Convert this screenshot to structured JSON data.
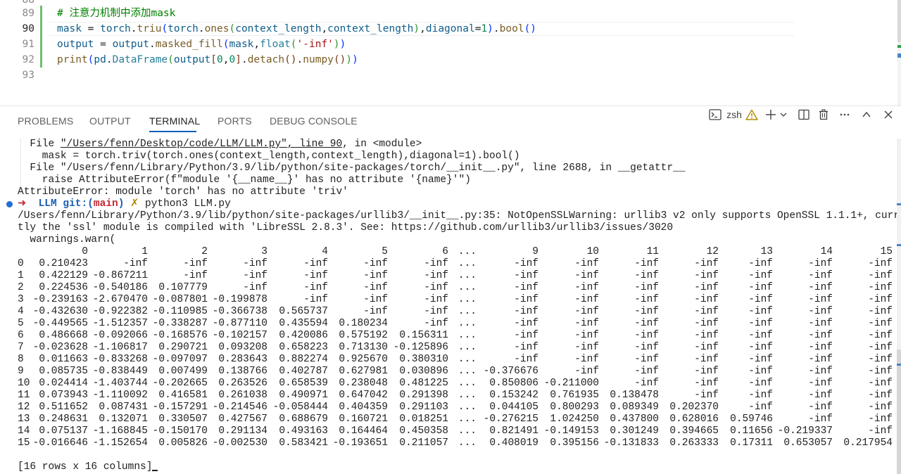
{
  "editor": {
    "lines": [
      {
        "num": "88",
        "tokens": []
      },
      {
        "num": "89",
        "tokens": [
          {
            "t": "# 注意力机制中添加mask",
            "c": "c-com"
          }
        ]
      },
      {
        "num": "90",
        "tokens": [
          {
            "t": "mask",
            "c": "c-var"
          },
          {
            "t": " = ",
            "c": "c-op"
          },
          {
            "t": "torch",
            "c": "c-var"
          },
          {
            "t": ".",
            "c": "c-op"
          },
          {
            "t": "triu",
            "c": "c-fn"
          },
          {
            "t": "(",
            "c": "b1"
          },
          {
            "t": "torch",
            "c": "c-var"
          },
          {
            "t": ".",
            "c": "c-op"
          },
          {
            "t": "ones",
            "c": "c-fn"
          },
          {
            "t": "(",
            "c": "b2"
          },
          {
            "t": "context_length",
            "c": "c-var"
          },
          {
            "t": ",",
            "c": "c-op"
          },
          {
            "t": "context_length",
            "c": "c-var"
          },
          {
            "t": ")",
            "c": "b2"
          },
          {
            "t": ",",
            "c": "c-op"
          },
          {
            "t": "diagonal",
            "c": "c-var"
          },
          {
            "t": "=",
            "c": "c-op"
          },
          {
            "t": "1",
            "c": "c-num"
          },
          {
            "t": ")",
            "c": "b1"
          },
          {
            "t": ".",
            "c": "c-op"
          },
          {
            "t": "bool",
            "c": "c-fn"
          },
          {
            "t": "()",
            "c": "b1"
          }
        ]
      },
      {
        "num": "91",
        "tokens": [
          {
            "t": "output",
            "c": "c-var"
          },
          {
            "t": " = ",
            "c": "c-op"
          },
          {
            "t": "output",
            "c": "c-var"
          },
          {
            "t": ".",
            "c": "c-op"
          },
          {
            "t": "masked_fill",
            "c": "c-fn"
          },
          {
            "t": "(",
            "c": "b1"
          },
          {
            "t": "mask",
            "c": "c-var"
          },
          {
            "t": ",",
            "c": "c-op"
          },
          {
            "t": "float",
            "c": "c-cls"
          },
          {
            "t": "(",
            "c": "b2"
          },
          {
            "t": "'-inf'",
            "c": "c-str"
          },
          {
            "t": ")",
            "c": "b2"
          },
          {
            "t": ")",
            "c": "b1"
          }
        ]
      },
      {
        "num": "92",
        "tokens": [
          {
            "t": "print",
            "c": "c-fn"
          },
          {
            "t": "(",
            "c": "b1"
          },
          {
            "t": "pd",
            "c": "c-var"
          },
          {
            "t": ".",
            "c": "c-op"
          },
          {
            "t": "DataFrame",
            "c": "c-cls"
          },
          {
            "t": "(",
            "c": "b2"
          },
          {
            "t": "output",
            "c": "c-var"
          },
          {
            "t": "[",
            "c": "b3"
          },
          {
            "t": "0",
            "c": "c-num"
          },
          {
            "t": ",",
            "c": "c-op"
          },
          {
            "t": "0",
            "c": "c-num"
          },
          {
            "t": "]",
            "c": "b3"
          },
          {
            "t": ".",
            "c": "c-op"
          },
          {
            "t": "detach",
            "c": "c-fn"
          },
          {
            "t": "()",
            "c": "b3"
          },
          {
            "t": ".",
            "c": "c-op"
          },
          {
            "t": "numpy",
            "c": "c-fn"
          },
          {
            "t": "()",
            "c": "b3"
          },
          {
            "t": ")",
            "c": "b2"
          },
          {
            "t": ")",
            "c": "b1"
          }
        ]
      },
      {
        "num": "93",
        "tokens": []
      }
    ]
  },
  "panel": {
    "tabs": [
      {
        "label": "PROBLEMS",
        "active": false
      },
      {
        "label": "OUTPUT",
        "active": false
      },
      {
        "label": "TERMINAL",
        "active": true
      },
      {
        "label": "PORTS",
        "active": false
      },
      {
        "label": "DEBUG CONSOLE",
        "active": false
      }
    ],
    "shell": "zsh",
    "icons": [
      "terminal-icon",
      "warning-icon",
      "plus-icon",
      "chevron-down-icon",
      "split-icon",
      "trash-icon",
      "more-icon",
      "maximize-icon",
      "close-icon"
    ]
  },
  "terminal": {
    "traceback": [
      {
        "a": "  File ",
        "u": "\"/Users/fenn/Desktop/code/LLM/LLM.py\", line 90",
        "b": ", in <module>"
      },
      {
        "a": "    mask = torch.triv(torch.ones(context_length,context_length),diagonal=1).bool()"
      },
      {
        "a": "  File \"/Users/fenn/Library/Python/3.9/lib/python/site-packages/torch/__init__.py\", line 2688, in __getattr__"
      },
      {
        "a": "    raise AttributeError(f\"module '{__name__}' has no attribute '{name}'\")"
      },
      {
        "a": "AttributeError: module 'torch' has no attribute 'triv'"
      }
    ],
    "prompt": {
      "arrow": "➜",
      "dir": "LLM",
      "git_label": "git:",
      "paren_open": "(",
      "branch": "main",
      "paren_close": ")",
      "dirty": "✗",
      "command": "python3 LLM.py"
    },
    "warning_lines": [
      "/Users/fenn/Library/Python/3.9/lib/python/site-packages/urllib3/__init__.py:35: NotOpenSSLWarning: urllib3 v2 only supports OpenSSL 1.1.1+, curren",
      "tly the 'ssl' module is compiled with 'LibreSSL 2.8.3'. See: https://github.com/urllib3/urllib3/issues/3020",
      "  warnings.warn("
    ],
    "df_columns": [
      "0",
      "1",
      "2",
      "3",
      "4",
      "5",
      "6",
      "...",
      "9",
      "10",
      "11",
      "12",
      "13",
      "14",
      "15"
    ],
    "df_rows": [
      [
        "0",
        "0.210423",
        "-inf",
        "-inf",
        "-inf",
        "-inf",
        "-inf",
        "-inf",
        "...",
        "-inf",
        "-inf",
        "-inf",
        "-inf",
        "-inf",
        "-inf",
        "-inf"
      ],
      [
        "1",
        "0.422129",
        "-0.867211",
        "-inf",
        "-inf",
        "-inf",
        "-inf",
        "-inf",
        "...",
        "-inf",
        "-inf",
        "-inf",
        "-inf",
        "-inf",
        "-inf",
        "-inf"
      ],
      [
        "2",
        "0.224536",
        "-0.540186",
        "0.107779",
        "-inf",
        "-inf",
        "-inf",
        "-inf",
        "...",
        "-inf",
        "-inf",
        "-inf",
        "-inf",
        "-inf",
        "-inf",
        "-inf"
      ],
      [
        "3",
        "-0.239163",
        "-2.670470",
        "-0.087801",
        "-0.199878",
        "-inf",
        "-inf",
        "-inf",
        "...",
        "-inf",
        "-inf",
        "-inf",
        "-inf",
        "-inf",
        "-inf",
        "-inf"
      ],
      [
        "4",
        "-0.432630",
        "-0.922382",
        "-0.110985",
        "-0.366738",
        "0.565737",
        "-inf",
        "-inf",
        "...",
        "-inf",
        "-inf",
        "-inf",
        "-inf",
        "-inf",
        "-inf",
        "-inf"
      ],
      [
        "5",
        "-0.449565",
        "-1.512357",
        "-0.338287",
        "-0.877110",
        "0.435594",
        "0.180234",
        "-inf",
        "...",
        "-inf",
        "-inf",
        "-inf",
        "-inf",
        "-inf",
        "-inf",
        "-inf"
      ],
      [
        "6",
        "0.486668",
        "-0.092066",
        "-0.168576",
        "-0.102157",
        "0.420086",
        "0.575192",
        "0.156311",
        "...",
        "-inf",
        "-inf",
        "-inf",
        "-inf",
        "-inf",
        "-inf",
        "-inf"
      ],
      [
        "7",
        "-0.023628",
        "-1.106817",
        "0.290721",
        "0.093208",
        "0.658223",
        "0.713130",
        "-0.125896",
        "...",
        "-inf",
        "-inf",
        "-inf",
        "-inf",
        "-inf",
        "-inf",
        "-inf"
      ],
      [
        "8",
        "0.011663",
        "-0.833268",
        "-0.097097",
        "0.283643",
        "0.882274",
        "0.925670",
        "0.380310",
        "...",
        "-inf",
        "-inf",
        "-inf",
        "-inf",
        "-inf",
        "-inf",
        "-inf"
      ],
      [
        "9",
        "0.085735",
        "-0.838449",
        "0.007499",
        "0.138766",
        "0.402787",
        "0.627981",
        "0.030896",
        "...",
        "-0.376676",
        "-inf",
        "-inf",
        "-inf",
        "-inf",
        "-inf",
        "-inf"
      ],
      [
        "10",
        "0.024414",
        "-1.403744",
        "-0.202665",
        "0.263526",
        "0.658539",
        "0.238048",
        "0.481225",
        "...",
        "0.850806",
        "-0.211000",
        "-inf",
        "-inf",
        "-inf",
        "-inf",
        "-inf"
      ],
      [
        "11",
        "0.073943",
        "-1.110092",
        "0.416581",
        "0.261038",
        "0.490971",
        "0.647042",
        "0.291398",
        "...",
        "0.153242",
        "0.761935",
        "0.138478",
        "-inf",
        "-inf",
        "-inf",
        "-inf"
      ],
      [
        "12",
        "0.511652",
        "0.087431",
        "-0.157291",
        "-0.214546",
        "-0.058444",
        "0.404359",
        "0.291103",
        "...",
        "0.044105",
        "0.800293",
        "0.089349",
        "0.202370",
        "-inf",
        "-inf",
        "-inf"
      ],
      [
        "13",
        "0.248631",
        "0.132071",
        "0.330507",
        "0.427567",
        "0.688679",
        "0.160721",
        "0.018251",
        "...",
        "-0.276215",
        "1.024250",
        "0.437800",
        "0.628016",
        "0.59746",
        "-inf",
        "-inf"
      ],
      [
        "14",
        "0.075137",
        "-1.168845",
        "-0.150170",
        "0.291134",
        "0.493163",
        "0.164464",
        "0.450358",
        "...",
        "0.821491",
        "-0.149153",
        "0.301249",
        "0.394665",
        "0.11656",
        "-0.219337",
        "-inf"
      ],
      [
        "15",
        "-0.016646",
        "-1.152654",
        "0.005826",
        "-0.002530",
        "0.583421",
        "-0.193651",
        "0.211057",
        "...",
        "0.408019",
        "0.395156",
        "-0.131833",
        "0.263333",
        "0.17311",
        "0.653057",
        "0.217954"
      ]
    ],
    "summary": "[16 rows x 16 columns]"
  }
}
